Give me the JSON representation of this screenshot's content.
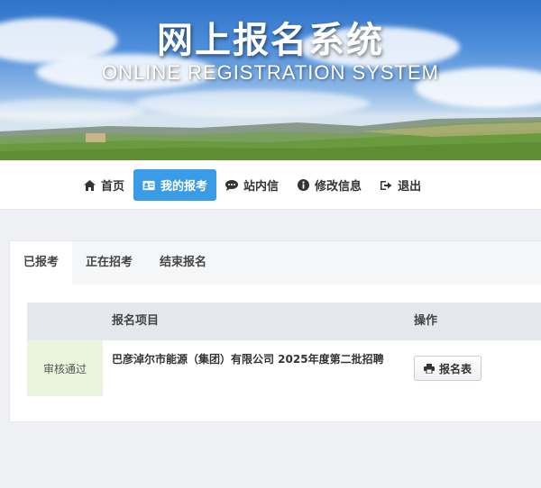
{
  "banner": {
    "title": "网上报名系统",
    "subtitle": "ONLINE REGISTRATION SYSTEM"
  },
  "nav": {
    "items": [
      {
        "label": "首页",
        "icon": "home-icon"
      },
      {
        "label": "我的报考",
        "icon": "id-card-icon",
        "active": true
      },
      {
        "label": "站内信",
        "icon": "chat-icon"
      },
      {
        "label": "修改信息",
        "icon": "info-icon"
      },
      {
        "label": "退出",
        "icon": "sign-out-icon"
      }
    ]
  },
  "tabs": [
    "已报考",
    "正在招考",
    "结束报名"
  ],
  "table": {
    "headers": [
      "报名项目",
      "操作"
    ],
    "rows": [
      {
        "status": "审核通过",
        "project": "巴彦淖尔市能源（集团）有限公司 2025年度第二批招聘",
        "action": "报名表"
      }
    ]
  },
  "colors": {
    "accent": "#3a9be6",
    "status_bg": "#e9f5dc",
    "header_bg": "#e4e7ec"
  }
}
